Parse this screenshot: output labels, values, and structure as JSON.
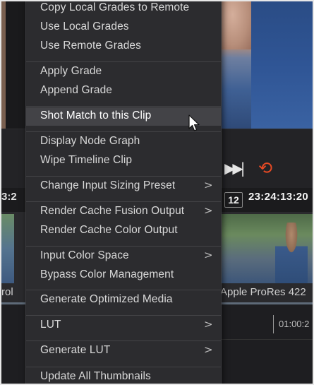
{
  "viewer": {
    "timecode_left": "3:2",
    "frame_field": "12",
    "timecode": "23:24:13:20"
  },
  "transport": {
    "skip_icon": "skip-to-end-icon",
    "loop_icon": "loop-icon",
    "loop_color": "#e84a24"
  },
  "clips": {
    "left_label": "rol",
    "right_label": "Apple ProRes 422"
  },
  "timeline": {
    "time_label": "01:00:2"
  },
  "context_menu": {
    "items": [
      {
        "label": "Copy Local Grades to Remote",
        "submenu": false
      },
      {
        "label": "Use Local Grades",
        "submenu": false
      },
      {
        "label": "Use Remote Grades",
        "submenu": false
      },
      {
        "label": "Apply Grade",
        "submenu": false
      },
      {
        "label": "Append Grade",
        "submenu": false
      },
      {
        "label": "Shot Match to this Clip",
        "submenu": false,
        "highlighted": true
      },
      {
        "label": "Display Node Graph",
        "submenu": false
      },
      {
        "label": "Wipe Timeline Clip",
        "submenu": false
      },
      {
        "label": "Change Input Sizing Preset",
        "submenu": true
      },
      {
        "label": "Render Cache Fusion Output",
        "submenu": true
      },
      {
        "label": "Render Cache Color Output",
        "submenu": false
      },
      {
        "label": "Input Color Space",
        "submenu": true
      },
      {
        "label": "Bypass Color Management",
        "submenu": false
      },
      {
        "label": "Generate Optimized Media",
        "submenu": false
      },
      {
        "label": "LUT",
        "submenu": true
      },
      {
        "label": "Generate LUT",
        "submenu": true
      },
      {
        "label": "Update All Thumbnails",
        "submenu": false
      }
    ],
    "arrow_glyph": ">"
  },
  "cursor_icon": "mouse-pointer-icon"
}
